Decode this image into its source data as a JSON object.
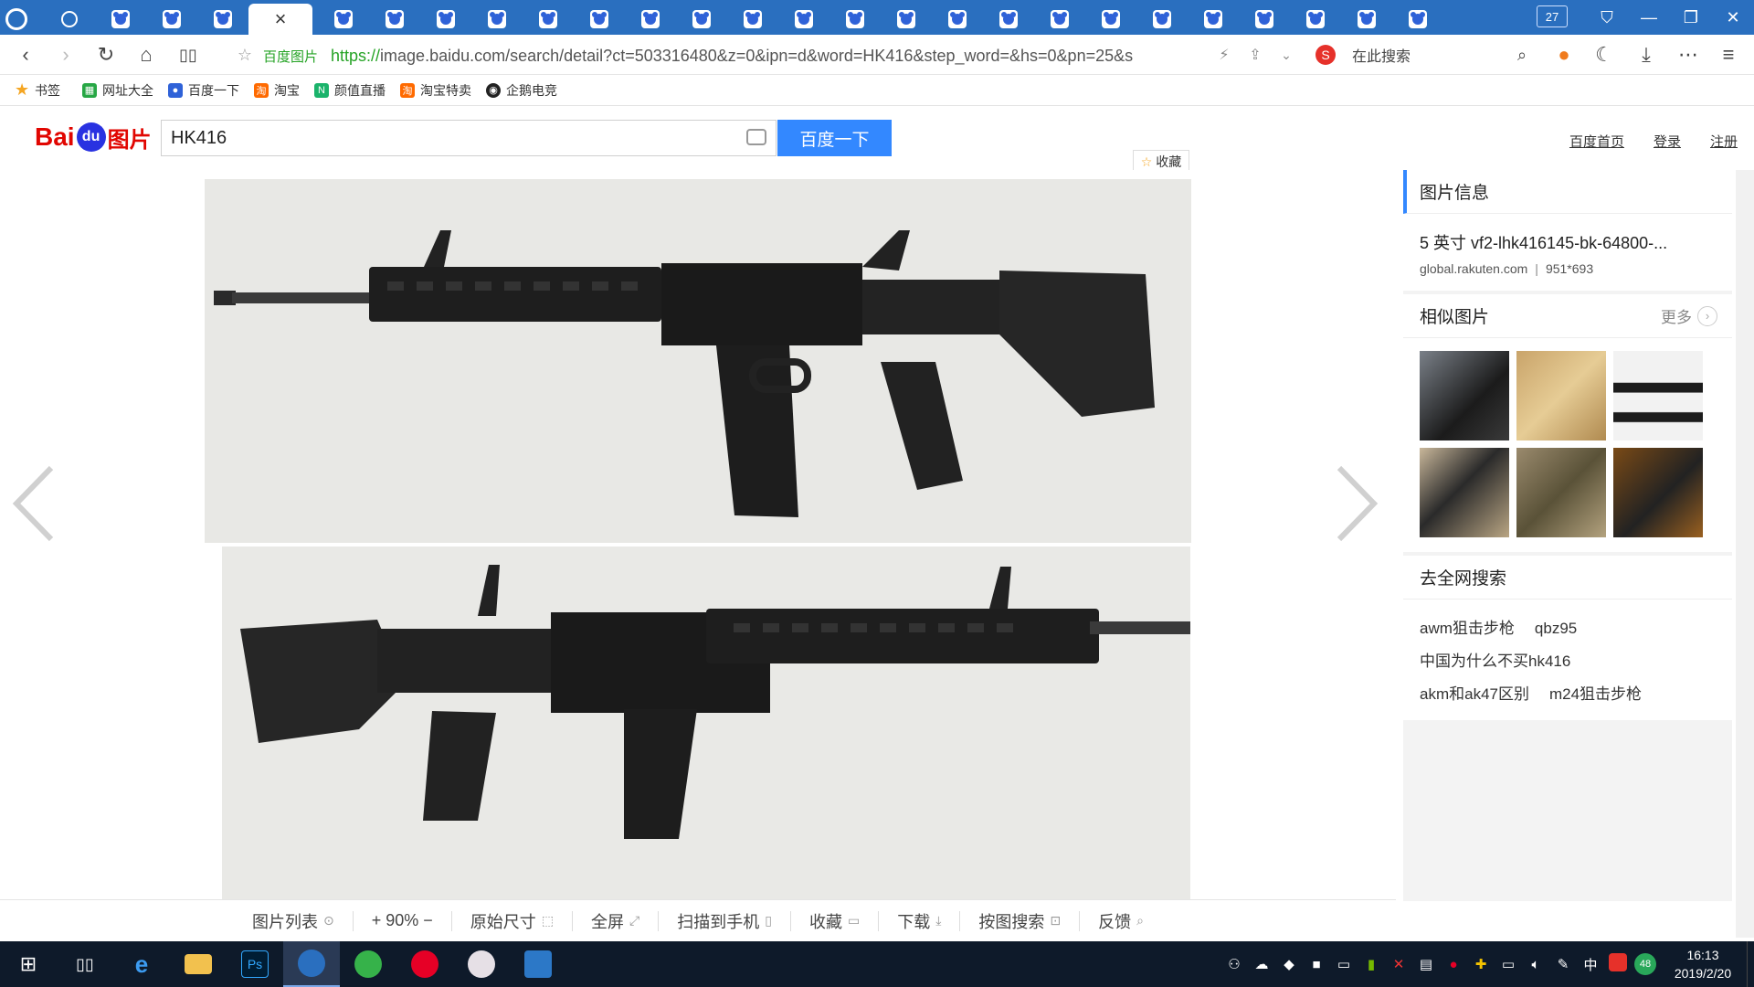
{
  "browser": {
    "tab_count": "27",
    "active_tab_close": "×",
    "site_label": "百度图片",
    "url_scheme": "https://",
    "url_rest": "image.baidu.com/search/detail?ct=503316480&z=0&ipn=d&word=HK416&step_word=&hs=0&pn=25&s",
    "search_placeholder": "在此搜索",
    "window_controls": [
      "—",
      "❐",
      "✕"
    ]
  },
  "bookmarks": [
    {
      "label": "书签",
      "color": "#f5a623",
      "icon": "star-icon"
    },
    {
      "label": "网址大全",
      "color": "#27a745",
      "icon": "grid-icon"
    },
    {
      "label": "百度一下",
      "color": "#2f62d8",
      "icon": "paw-icon"
    },
    {
      "label": "淘宝",
      "color": "#ff6a00",
      "icon": "taobao-icon"
    },
    {
      "label": "颜值直播",
      "color": "#1bb36b",
      "icon": "live-icon"
    },
    {
      "label": "淘宝特卖",
      "color": "#ff6a00",
      "icon": "taobao-icon"
    },
    {
      "label": "企鹅电竞",
      "color": "#222222",
      "icon": "penguin-icon"
    }
  ],
  "baidu": {
    "logo_bai": "Bai",
    "logo_du": "du",
    "logo_tupian": "图片",
    "query": "HK416",
    "search_button": "百度一下",
    "links": [
      "百度首页",
      "登录",
      "注册"
    ],
    "fav_label": "收藏"
  },
  "panel": {
    "info_title": "图片信息",
    "info_name": "5 英寸 vf2-lhk416145-bk-64800-...",
    "info_source": "global.rakuten.com",
    "info_size": "951*693",
    "similar_title": "相似图片",
    "similar_more": "更多",
    "web_title": "去全网搜索",
    "keywords": [
      [
        "awm狙击步枪",
        "qbz95"
      ],
      [
        "中国为什么不买hk416"
      ],
      [
        "akm和ak47区别",
        "m24狙击步枪"
      ]
    ]
  },
  "toolbar": [
    {
      "label": "图片列表",
      "glyph": "⊙"
    },
    {
      "label": "+  90%  −",
      "glyph": ""
    },
    {
      "label": "原始尺寸",
      "glyph": "⬚"
    },
    {
      "label": "全屏",
      "glyph": "⤢"
    },
    {
      "label": "扫描到手机",
      "glyph": "▯"
    },
    {
      "label": "收藏",
      "glyph": "▭"
    },
    {
      "label": "下载",
      "glyph": "⤓"
    },
    {
      "label": "按图搜索",
      "glyph": "⊡"
    },
    {
      "label": "反馈",
      "glyph": "⌕"
    }
  ],
  "taskbar": {
    "time": "16:13",
    "date": "2019/2/20",
    "ime": "中",
    "badge": "48"
  },
  "colors": {
    "accent": "#3388ff",
    "tabbar": "#2a6fbf",
    "baidu_red": "#e10601"
  }
}
